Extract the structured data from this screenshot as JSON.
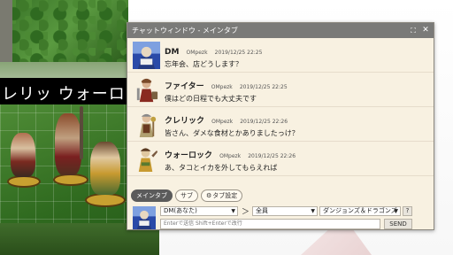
{
  "background": {
    "banner_text": "レリッ ウォーロッ"
  },
  "window": {
    "title": "チャットウィンドウ - メインタブ",
    "maximize_icon": "maximize-icon",
    "close_icon": "close-icon"
  },
  "messages": [
    {
      "name": "DM",
      "user": "OMpezk",
      "time": "2019/12/25 22:25",
      "text": "忘年会、店どうします？",
      "avatar": "dm-avatar"
    },
    {
      "name": "ファイター",
      "user": "OMpezk",
      "time": "2019/12/25 22:25",
      "text": "僕はどの日程でも大丈夫です",
      "avatar": "fighter-avatar"
    },
    {
      "name": "クレリック",
      "user": "OMpezk",
      "time": "2019/12/25 22:26",
      "text": "皆さん、ダメな食材とかありましたっけ？",
      "avatar": "cleric-avatar"
    },
    {
      "name": "ウォーロック",
      "user": "OMpezk",
      "time": "2019/12/25 22:26",
      "text": "あ、タコとイカを外してもらえれば",
      "avatar": "warlock-avatar"
    }
  ],
  "tabs": [
    {
      "label": "メインタブ",
      "active": true
    },
    {
      "label": "サブ",
      "active": false
    },
    {
      "label": "タブ設定",
      "active": false,
      "icon": "gear-icon"
    }
  ],
  "composer": {
    "character_select": "DM(あなた)",
    "arrow": "＞",
    "target_select": "全員",
    "system_select": "ダンジョンズ＆ドラゴンズ",
    "help_label": "?",
    "input_placeholder": "Enterで送信  Shift+Enterで改行",
    "send_label": "SEND"
  },
  "colors": {
    "window_bg": "#f8f1e1",
    "titlebar": "#7a7a78",
    "active_tab": "#5b5b5b"
  }
}
